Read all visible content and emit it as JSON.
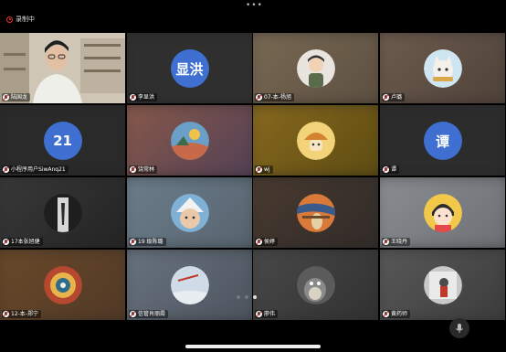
{
  "status_bar": {
    "recording_label": "录制中",
    "more_glyph": "•••"
  },
  "colors": {
    "avatar_initial_bg": "#3f6fd1",
    "muted_red": "#e33333",
    "page_dot_active": "#dddddd",
    "page_dot_inactive": "#777777"
  },
  "participants": [
    {
      "name": "陆国龙",
      "type": "video"
    },
    {
      "name": "李显洪",
      "type": "initial",
      "initial": "显洪"
    },
    {
      "name": "07-本-杨旭",
      "type": "photo",
      "icon": "cartoon-boy-avatar"
    },
    {
      "name": "卢璐",
      "type": "photo",
      "icon": "cat-avatar"
    },
    {
      "name": "小程序用户SiwAnq21",
      "type": "initial",
      "initial": "21"
    },
    {
      "name": "饶常林",
      "type": "photo",
      "icon": "painting-avatar"
    },
    {
      "name": "wj",
      "type": "photo",
      "icon": "mushroom-avatar"
    },
    {
      "name": "谭",
      "type": "initial",
      "initial": "谭"
    },
    {
      "name": "17本张旭健",
      "type": "photo",
      "icon": "person-dark-avatar"
    },
    {
      "name": "19 级陈璐",
      "type": "photo",
      "icon": "hat-character-avatar"
    },
    {
      "name": "侯婷",
      "type": "photo",
      "icon": "scream-painting-avatar"
    },
    {
      "name": "王晓丹",
      "type": "photo",
      "icon": "chibi-maruko-avatar"
    },
    {
      "name": "12-本-郑宁",
      "type": "photo",
      "icon": "pattern-avatar"
    },
    {
      "name": "信管肖丽霞",
      "type": "photo",
      "icon": "sky-avatar"
    },
    {
      "name": "廖伟",
      "type": "photo",
      "icon": "totoro-avatar"
    },
    {
      "name": "黄药师",
      "type": "photo",
      "icon": "figure-avatar"
    }
  ],
  "pagination": {
    "total": 3,
    "active": 3
  }
}
